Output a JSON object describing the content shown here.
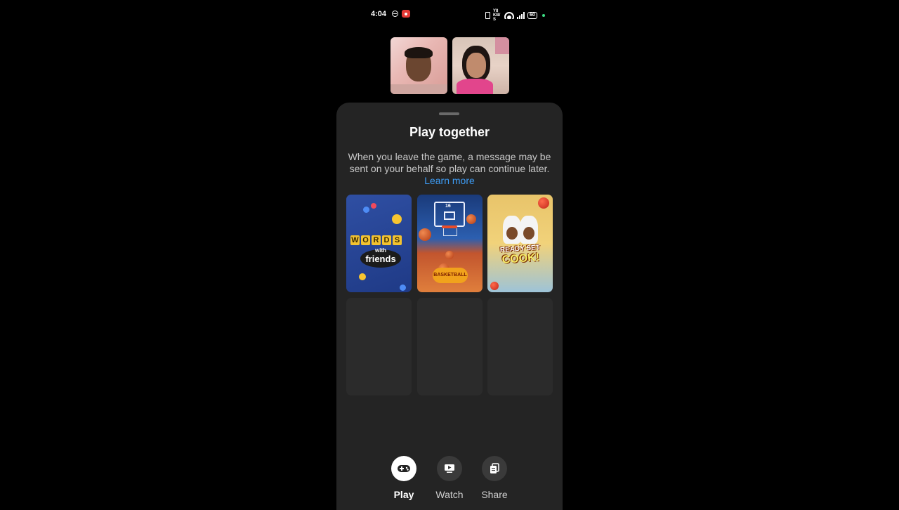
{
  "status_bar": {
    "time": "4:04",
    "network_label": "Y8 KB/S",
    "battery": "60"
  },
  "call": {
    "participants": [
      "participant-1",
      "participant-2"
    ]
  },
  "sheet": {
    "title": "Play together",
    "description": "When you leave the game, a message may be sent on your behalf so play can continue later.",
    "learn_more": "Learn more"
  },
  "games": [
    {
      "name": "Words with Friends",
      "logo_top": "WORDS",
      "logo_sub": "with",
      "logo_main": "friends",
      "accent": "#2f4fa3"
    },
    {
      "name": "Basketball FRVR",
      "logo": "BASKETBALL",
      "score": "16",
      "accent": "#e07f3c"
    },
    {
      "name": "Ready Set Cook",
      "logo_line1": "READY SET",
      "logo_line2": "COOK!",
      "accent": "#f1d27a"
    }
  ],
  "nav": [
    {
      "label": "Play",
      "icon": "gamepad-icon",
      "active": true
    },
    {
      "label": "Watch",
      "icon": "video-icon",
      "active": false
    },
    {
      "label": "Share",
      "icon": "share-screen-icon",
      "active": false
    }
  ],
  "colors": {
    "background": "#000000",
    "sheet": "#242424",
    "link": "#3d9cf5",
    "placeholder": "#2b2b2b"
  }
}
